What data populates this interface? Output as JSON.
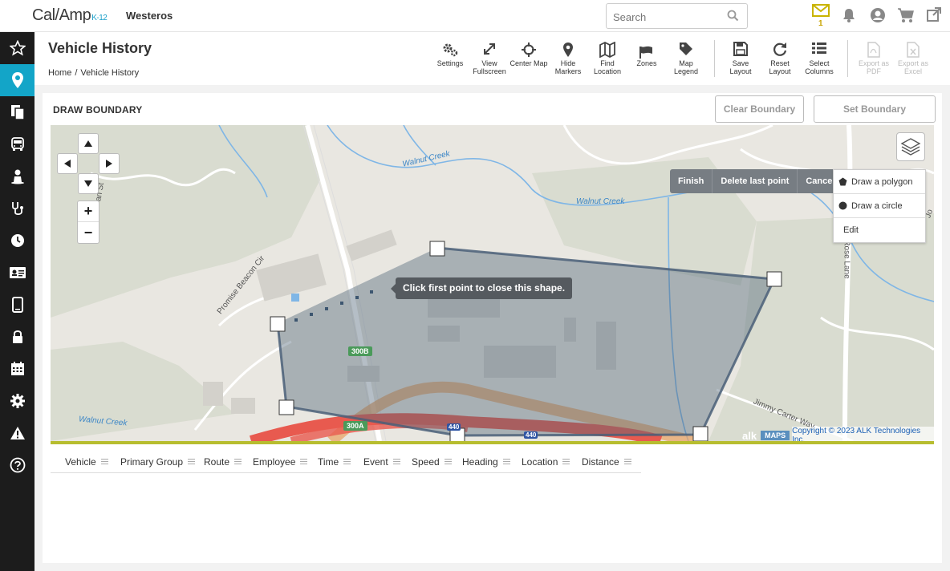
{
  "header": {
    "logo_main": "Cal/Amp",
    "logo_sub": "K-12",
    "org_name": "Westeros",
    "search_placeholder": "Search",
    "message_count": "1"
  },
  "page": {
    "title": "Vehicle History",
    "breadcrumb": [
      "Home",
      "Vehicle History"
    ]
  },
  "toolbar": [
    {
      "label": "Settings",
      "icon": "gears-icon"
    },
    {
      "label": "View Fullscreen",
      "icon": "expand-icon"
    },
    {
      "label": "Center Map",
      "icon": "crosshair-icon"
    },
    {
      "label": "Hide Markers",
      "icon": "map-marker-icon"
    },
    {
      "label": "Find Location",
      "icon": "map-icon"
    },
    {
      "label": "Zones",
      "icon": "flag-icon"
    },
    {
      "label": "Map Legend",
      "icon": "tag-icon"
    },
    {
      "label": "Save Layout",
      "icon": "save-icon"
    },
    {
      "label": "Reset Layout",
      "icon": "refresh-icon"
    },
    {
      "label": "Select Columns",
      "icon": "list-icon"
    },
    {
      "label": "Export as PDF",
      "icon": "pdf-file-icon",
      "disabled": true
    },
    {
      "label": "Export as Excel",
      "icon": "excel-file-icon",
      "disabled": true
    }
  ],
  "draw": {
    "title": "DRAW BOUNDARY",
    "clear_label": "Clear Boundary",
    "set_label": "Set Boundary",
    "finish_label": "Finish",
    "delete_label": "Delete last point",
    "cancel_label": "Cancel",
    "polygon_label": "Draw a polygon",
    "circle_label": "Draw a circle",
    "edit_label": "Edit",
    "tooltip": "Click first point to close this shape."
  },
  "map": {
    "labels": {
      "creek1": "Walnut Creek",
      "creek2": "Walnut Creek",
      "creek3": "Walnut Creek",
      "street1": "Promise Beacon Cir",
      "street2": "Rose Lane",
      "street3": "Jimmy Carter Way",
      "street4": "Jo",
      "street5": "an St",
      "exit1": "300B",
      "exit2": "300A",
      "hw1": "440",
      "hw2": "440"
    },
    "attribution_logo": "alk",
    "attribution_maps": "MAPS",
    "attribution_text": "Copyright © 2023 ALK Technologies Inc."
  },
  "columns": [
    "Vehicle",
    "Primary Group",
    "Route",
    "Employee",
    "Time",
    "Event",
    "Speed",
    "Heading",
    "Location",
    "Distance"
  ],
  "colors": {
    "accent": "#13a5c8",
    "sidebar": "#1c1c1c",
    "polygon": "#4a5f78",
    "mapbar": "#b7bd2f"
  }
}
